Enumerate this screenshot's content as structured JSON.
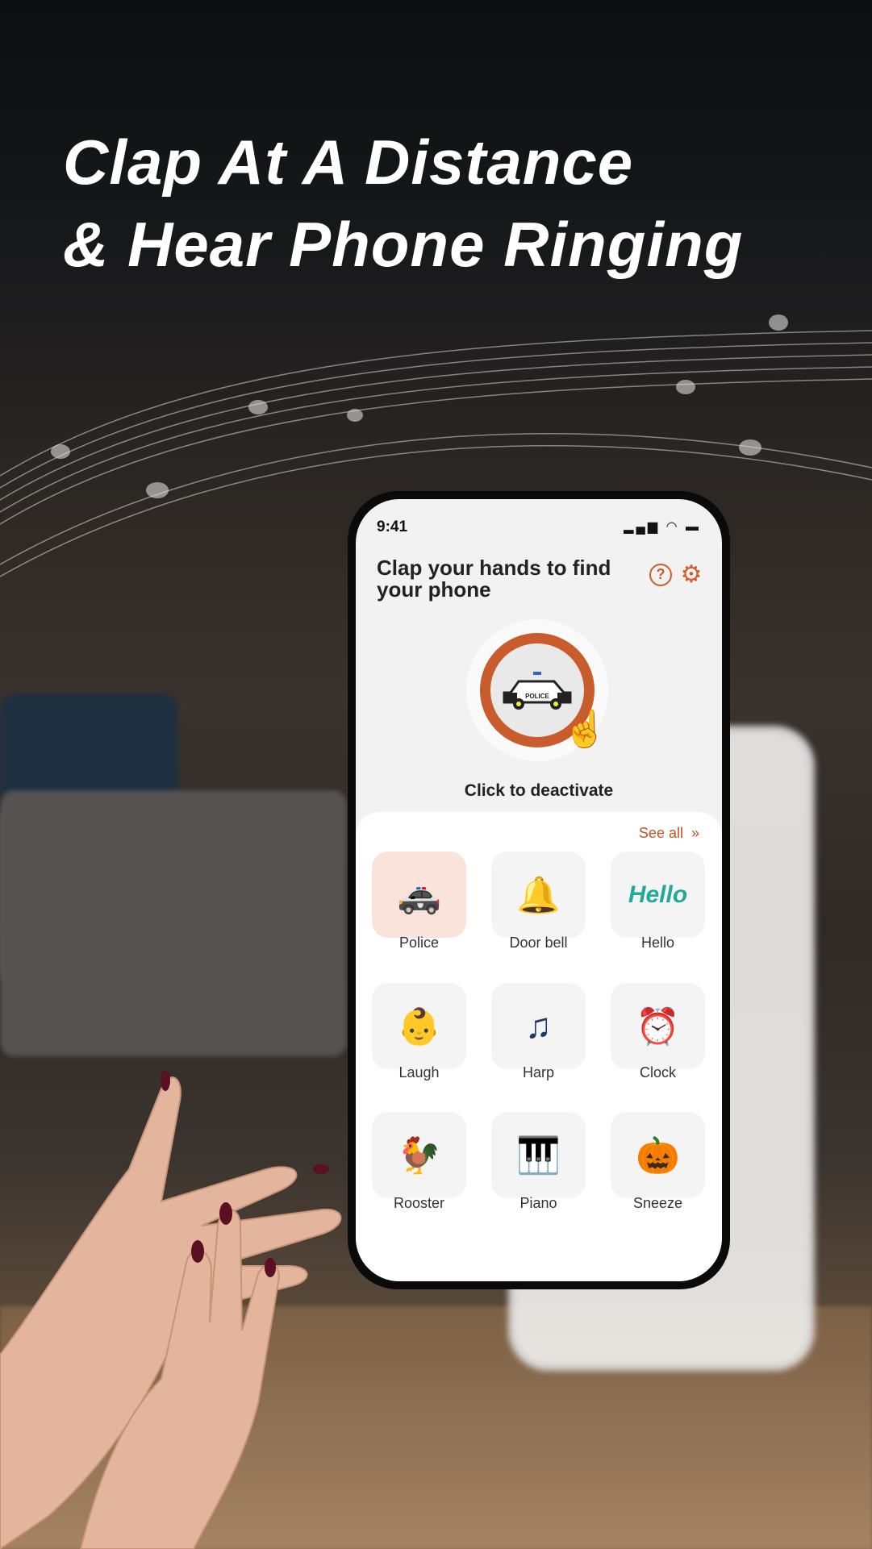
{
  "headline": {
    "line1": "Clap At A Distance",
    "line2": "& Hear Phone Ringing"
  },
  "phone": {
    "status_time": "9:41",
    "title": "Clap your hands to find your phone",
    "help_icon": "question-circle-icon",
    "settings_icon": "gear-icon",
    "main_button": {
      "icon": "police-car-icon",
      "label": "Click to deactivate"
    },
    "see_all": "See all",
    "accent": "#c85c2c",
    "sounds": [
      {
        "label": "Police",
        "icon": "police-car-icon",
        "selected": true
      },
      {
        "label": "Door bell",
        "icon": "bell-icon"
      },
      {
        "label": "Hello",
        "icon": "hello-text-icon"
      },
      {
        "label": "Laugh",
        "icon": "baby-icon"
      },
      {
        "label": "Harp",
        "icon": "harp-icon"
      },
      {
        "label": "Clock",
        "icon": "alarm-clock-icon"
      },
      {
        "label": "Rooster",
        "icon": "rooster-icon"
      },
      {
        "label": "Piano",
        "icon": "piano-icon"
      },
      {
        "label": "Sneeze",
        "icon": "pumpkin-sneeze-icon"
      }
    ]
  }
}
